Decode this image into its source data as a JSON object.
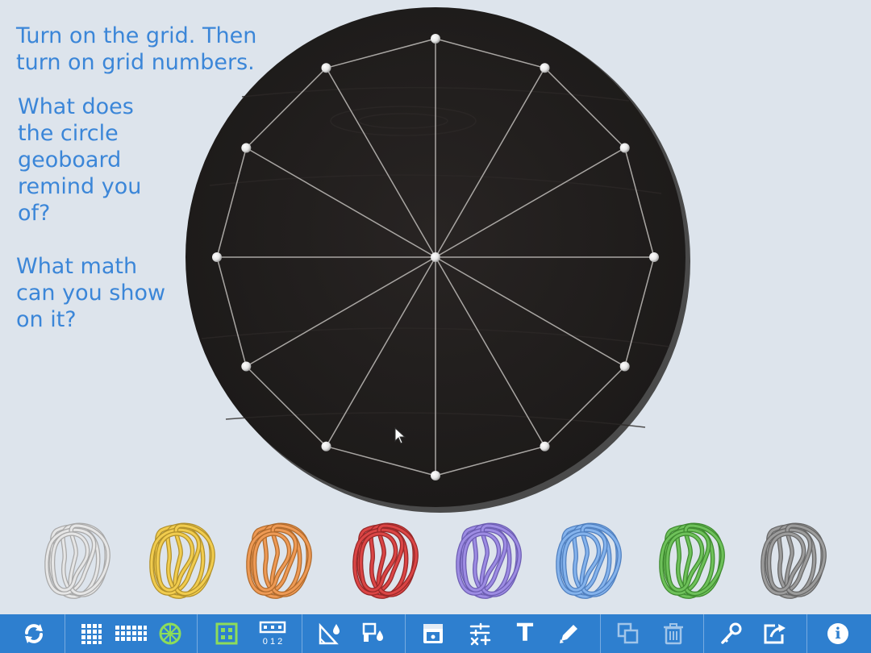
{
  "instructions": {
    "line1": "Turn on the grid. Then turn on grid numbers.",
    "line2": "What does the circle geoboard remind you of?",
    "line3": "What math can you show on it?"
  },
  "colors": {
    "background": "#dde4ec",
    "instruction_text": "#3b86d8",
    "board": "#211e1d",
    "peg": "#eeeeee",
    "toolbar": "#2e7fcf",
    "toolbar_icon": "#ffffff",
    "circle_tool_active": "#8ddc5a",
    "grid_tool_active": "#8ddc5a"
  },
  "geoboard": {
    "shape": "circle",
    "peg_count_on_rim": 12,
    "center_peg": true,
    "lines": "dodecagon outline plus spokes from center to every rim peg"
  },
  "rubber_bands": [
    {
      "name": "white",
      "color": "#e6e6e6",
      "edge": "#a8a8a8"
    },
    {
      "name": "yellow",
      "color": "#f1cc4e",
      "edge": "#b2912b"
    },
    {
      "name": "orange",
      "color": "#ee9a55",
      "edge": "#b06a2c"
    },
    {
      "name": "red",
      "color": "#db4545",
      "edge": "#972828"
    },
    {
      "name": "purple",
      "color": "#9d8ce3",
      "edge": "#6c5db2"
    },
    {
      "name": "blue",
      "color": "#85b3ec",
      "edge": "#4f7fbf"
    },
    {
      "name": "green",
      "color": "#6ec15a",
      "edge": "#3f8a30"
    },
    {
      "name": "gray",
      "color": "#9c9c9c",
      "edge": "#676767"
    }
  ],
  "toolbar": {
    "buttons": [
      {
        "name": "reset-icon"
      },
      {
        "name": "square-geoboard-icon"
      },
      {
        "name": "rectangle-geoboard-icon"
      },
      {
        "name": "circle-geoboard-icon",
        "active": true
      },
      {
        "name": "grid-icon",
        "active": true
      },
      {
        "name": "grid-numbers-icon",
        "label": "0 1 2"
      },
      {
        "name": "triangle-fill-icon"
      },
      {
        "name": "shape-fill-icon"
      },
      {
        "name": "hide-board-icon"
      },
      {
        "name": "measure-icon"
      },
      {
        "name": "text-icon",
        "label": "T"
      },
      {
        "name": "pencil-icon"
      },
      {
        "name": "duplicate-icon"
      },
      {
        "name": "trash-icon"
      },
      {
        "name": "key-icon"
      },
      {
        "name": "share-icon"
      },
      {
        "name": "info-icon",
        "label": "i"
      }
    ]
  }
}
